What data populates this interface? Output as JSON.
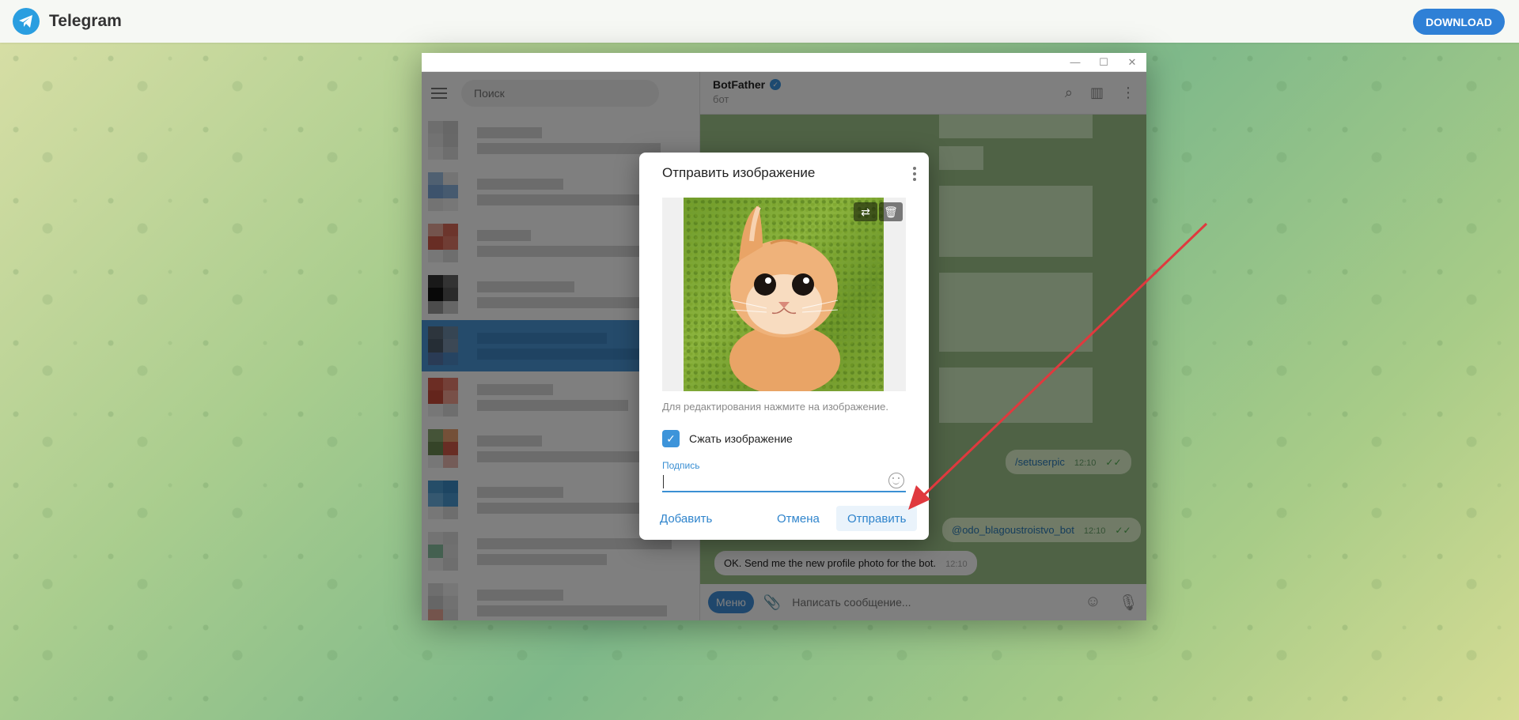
{
  "topbar": {
    "brand": "Telegram",
    "download_label": "DOWNLOAD"
  },
  "sidebar": {
    "search_placeholder": "Поиск"
  },
  "chat": {
    "title": "BotFather",
    "subtitle": "бот",
    "messages": [
      {
        "text": "/setuserpic",
        "time": "12:10",
        "direction": "out"
      },
      {
        "text": "@odo_blagoustroistvo_bot",
        "time": "12:10",
        "direction": "out"
      },
      {
        "text": "OK. Send me the new profile photo for the bot.",
        "time": "12:10",
        "direction": "in"
      }
    ],
    "composer": {
      "menu_label": "Меню",
      "placeholder": "Написать сообщение..."
    }
  },
  "modal": {
    "title": "Отправить изображение",
    "edit_hint": "Для редактирования нажмите на изображение.",
    "compress_label": "Сжать изображение",
    "compress_checked": true,
    "caption_label": "Подпись",
    "caption_value": "",
    "buttons": {
      "add": "Добавить",
      "cancel": "Отмена",
      "send": "Отправить"
    }
  },
  "colors": {
    "accent": "#3a8fd3",
    "download": "#2f80d6",
    "annotation_arrow": "#e0393e"
  }
}
